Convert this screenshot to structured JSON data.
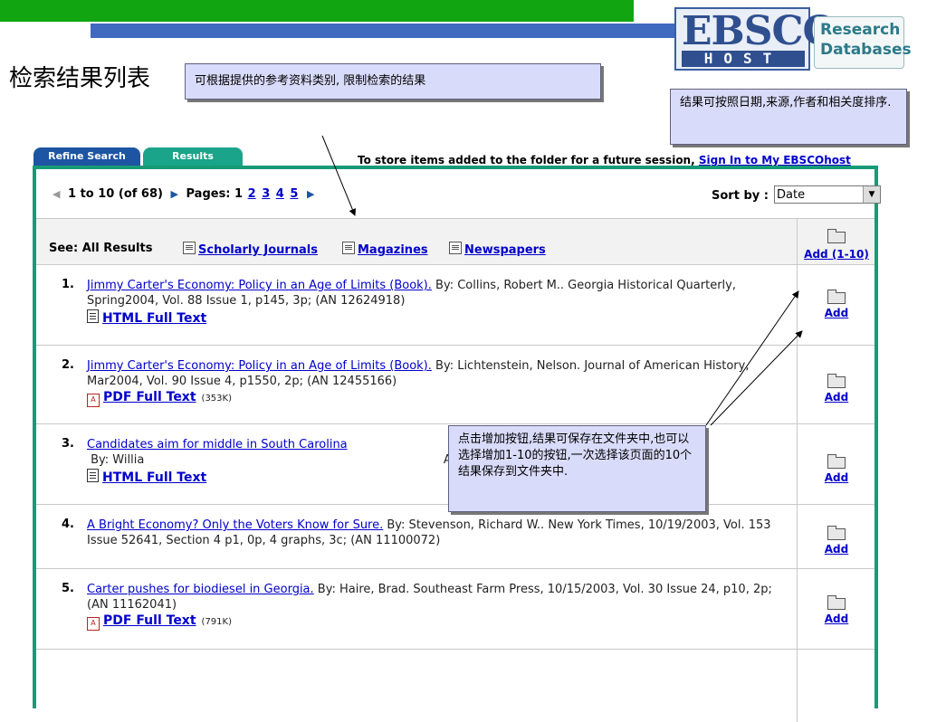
{
  "slide": {
    "title": "检索结果列表",
    "callout_filter": "可根据提供的参考资料类别, 限制检索的结果",
    "callout_sort": "结果可按照日期,来源,作者和相关度排序.",
    "callout_add": "点击增加按钮,结果可保存在文件夹中,也可以选择增加1-10的按钮,一次选择该页面的10个结果保存到文件夹中."
  },
  "logo": {
    "brand": "EBSCO",
    "host": "HOST",
    "research": "Research",
    "databases": "Databases"
  },
  "tabs": [
    {
      "label": "Refine Search"
    },
    {
      "label": "Results"
    }
  ],
  "store_note": {
    "text": "To store items added to the folder for a future session,",
    "link": "Sign In to My EBSCOhost"
  },
  "pager": {
    "range": "1 to 10",
    "of": "(of 68)",
    "pages_label": "Pages:",
    "current_page": "1",
    "pages": [
      "2",
      "3",
      "4",
      "5"
    ],
    "sort_label": "Sort by :",
    "sort_value": "Date"
  },
  "see": {
    "label": "See: All Results",
    "scholarly": "Scholarly Journals",
    "magazines": "Magazines",
    "newspapers": "Newspapers",
    "add_all": "Add (1-10)"
  },
  "results": [
    {
      "num": "1.",
      "title": "Jimmy Carter's Economy: Policy in an Age of Limits (Book).",
      "meta": " By: Collins, Robert M.. Georgia Historical Quarterly, Spring2004, Vol. 88 Issue 1, p145, 3p; (AN 12624918)",
      "fulltext": "HTML Full Text",
      "size": "",
      "add": "Add"
    },
    {
      "num": "2.",
      "title": "Jimmy Carter's Economy: Policy in an Age of Limits (Book).",
      "meta": " By: Lichtenstein, Nelson. Journal of American History, Mar2004, Vol. 90 Issue 4, p1550, 2p; (AN 12455166)",
      "fulltext": "PDF Full Text",
      "size": "(353K)",
      "add": "Add"
    },
    {
      "num": "3.",
      "title": "Candidates aim for middle in South Carolina",
      "meta": " By: Willia                                                                                AN J0E297243166104)",
      "fulltext": "HTML Full Text",
      "size": "",
      "add": "Add"
    },
    {
      "num": "4.",
      "title": "A Bright Economy? Only the Voters Know for Sure.",
      "meta": " By: Stevenson, Richard W.. New York Times, 10/19/2003, Vol. 153 Issue 52641, Section 4 p1, 0p, 4 graphs, 3c; (AN 11100072)",
      "fulltext": "",
      "size": "",
      "add": "Add"
    },
    {
      "num": "5.",
      "title": "Carter pushes for biodiesel in Georgia.",
      "meta": " By: Haire, Brad. Southeast Farm Press, 10/15/2003, Vol. 30 Issue 24, p10, 2p; (AN 11162041)",
      "fulltext": "PDF Full Text",
      "size": "(791K)",
      "add": "Add"
    }
  ]
}
